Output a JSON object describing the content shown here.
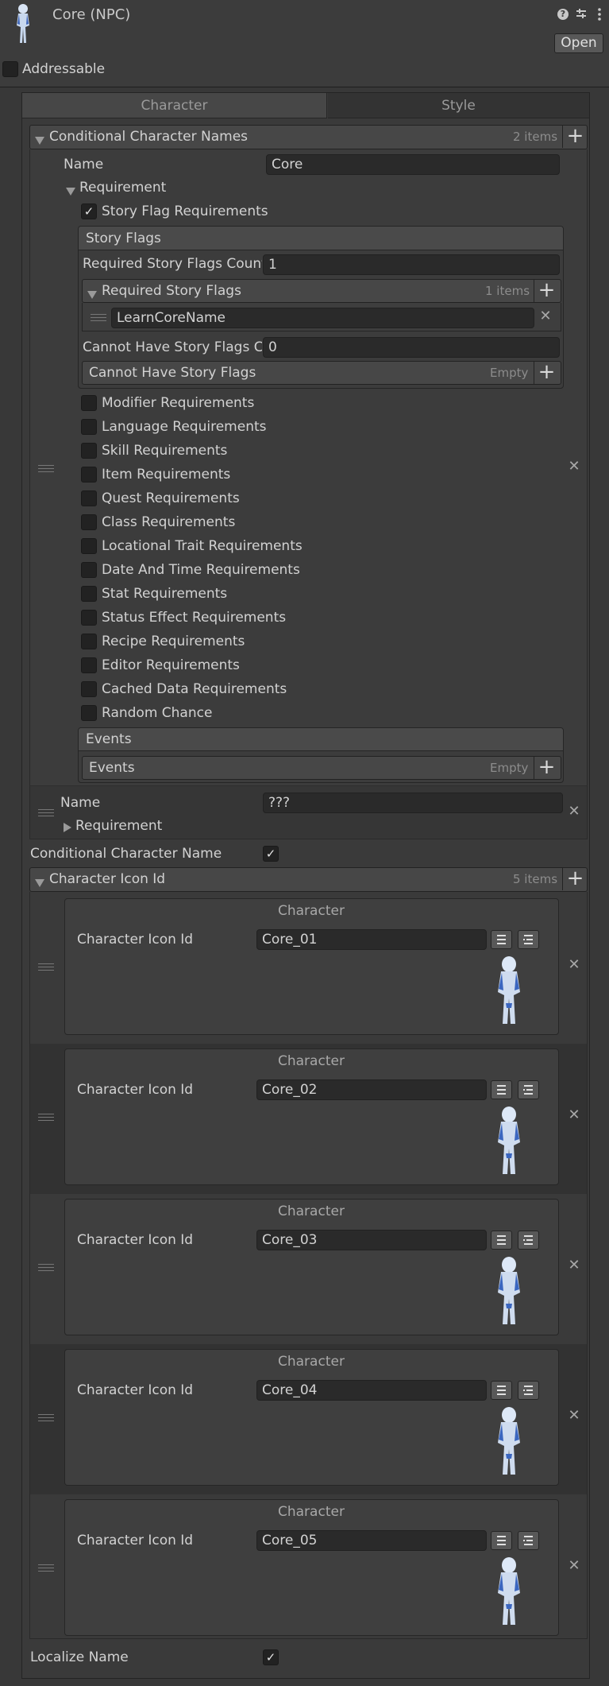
{
  "header": {
    "title": "Core (NPC)",
    "open_label": "Open",
    "addressable_label": "Addressable",
    "addressable_checked": false
  },
  "tabs": [
    {
      "label": "Character",
      "active": true
    },
    {
      "label": "Style",
      "active": false
    }
  ],
  "conditional_names": {
    "label": "Conditional Character Names",
    "count": "2 items",
    "element0": {
      "name_label": "Name",
      "name_value": "Core",
      "requirement_label": "Requirement",
      "story_flag_requirements_label": "Story Flag Requirements",
      "story_flags_title": "Story Flags",
      "required_count_label": "Required Story Flags Count",
      "required_count_value": "1",
      "required_list_label": "Required Story Flags",
      "required_list_count": "1 items",
      "required_item": "LearnCoreName",
      "cannot_count_label": "Cannot Have Story Flags Count",
      "cannot_count_value": "0",
      "cannot_list_label": "Cannot Have Story Flags",
      "cannot_list_count": "Empty",
      "requirement_checkboxes": [
        "Modifier Requirements",
        "Language Requirements",
        "Skill Requirements",
        "Item Requirements",
        "Quest Requirements",
        "Class Requirements",
        "Locational Trait Requirements",
        "Date And Time Requirements",
        "Stat Requirements",
        "Status Effect Requirements",
        "Recipe Requirements",
        "Editor Requirements",
        "Cached Data Requirements",
        "Random Chance"
      ],
      "events_title": "Events",
      "events_list_label": "Events",
      "events_list_count": "Empty"
    },
    "element1": {
      "name_label": "Name",
      "name_value": "???",
      "requirement_label": "Requirement"
    }
  },
  "conditional_character_name": {
    "label": "Conditional Character Name",
    "checked": true
  },
  "character_icon_id": {
    "label": "Character Icon Id",
    "count": "5 items",
    "cards": [
      {
        "title": "Character",
        "field_label": "Character Icon Id",
        "value": "Core_01"
      },
      {
        "title": "Character",
        "field_label": "Character Icon Id",
        "value": "Core_02"
      },
      {
        "title": "Character",
        "field_label": "Character Icon Id",
        "value": "Core_03"
      },
      {
        "title": "Character",
        "field_label": "Character Icon Id",
        "value": "Core_04"
      },
      {
        "title": "Character",
        "field_label": "Character Icon Id",
        "value": "Core_05"
      }
    ]
  },
  "localize_name": {
    "label": "Localize Name",
    "checked": true
  },
  "icons": {
    "help": "help-icon",
    "settings": "settings-icon",
    "more": "more-icon",
    "add": "add-icon",
    "remove": "remove-icon",
    "drag": "drag-handle-icon"
  },
  "colors": {
    "background": "#383838",
    "panel": "#3c3c3c",
    "field": "#2a2a2a",
    "header_bar": "#474747"
  }
}
